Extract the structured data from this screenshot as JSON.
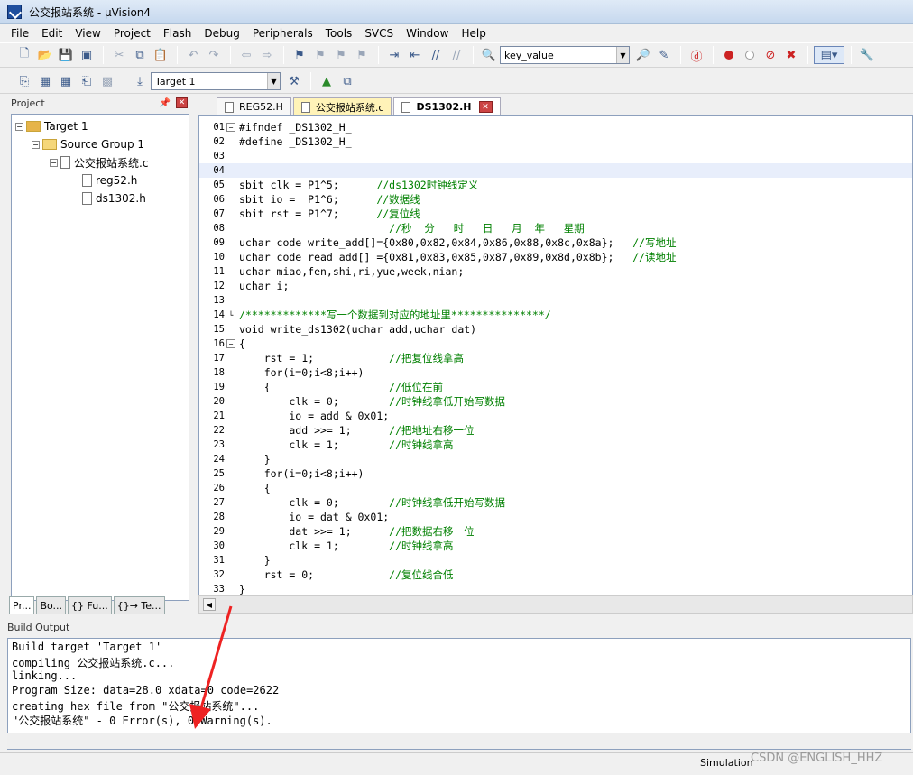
{
  "window": {
    "title": "公交报站系统 - µVision4"
  },
  "menu": [
    "File",
    "Edit",
    "View",
    "Project",
    "Flash",
    "Debug",
    "Peripherals",
    "Tools",
    "SVCS",
    "Window",
    "Help"
  ],
  "toolbar": {
    "find_value": "key_value",
    "target": "Target 1"
  },
  "project": {
    "header": "Project",
    "tree": [
      {
        "label": "Target 1"
      },
      {
        "label": "Source Group 1"
      },
      {
        "label": "公交报站系统.c"
      },
      {
        "label": "reg52.h"
      },
      {
        "label": "ds1302.h"
      }
    ],
    "tabs": [
      "Pr...",
      "Bo...",
      "{} Fu...",
      "{}→ Te..."
    ]
  },
  "editor_tabs": [
    {
      "label": "REG52.H"
    },
    {
      "label": "公交报站系统.c"
    },
    {
      "label": "DS1302.H"
    }
  ],
  "code": [
    {
      "n": "01",
      "t": "#ifndef _DS1302_H_",
      "c": ""
    },
    {
      "n": "02",
      "t": "#define _DS1302_H_",
      "c": ""
    },
    {
      "n": "03",
      "t": "",
      "c": ""
    },
    {
      "n": "04",
      "t": "",
      "c": ""
    },
    {
      "n": "05",
      "t": "sbit clk = P1^5;      ",
      "c": "//ds1302时钟线定义"
    },
    {
      "n": "06",
      "t": "sbit io =  P1^6;      ",
      "c": "//数据线"
    },
    {
      "n": "07",
      "t": "sbit rst = P1^7;      ",
      "c": "//复位线"
    },
    {
      "n": "08",
      "t": "                        ",
      "c": "//秒  分   时   日   月  年   星期"
    },
    {
      "n": "09",
      "t": "uchar code write_add[]={0x80,0x82,0x84,0x86,0x88,0x8c,0x8a};   ",
      "c": "//写地址"
    },
    {
      "n": "10",
      "t": "uchar code read_add[] ={0x81,0x83,0x85,0x87,0x89,0x8d,0x8b};   ",
      "c": "//读地址"
    },
    {
      "n": "11",
      "t": "uchar miao,fen,shi,ri,yue,week,nian;",
      "c": ""
    },
    {
      "n": "12",
      "t": "uchar i;",
      "c": ""
    },
    {
      "n": "13",
      "t": "",
      "c": ""
    },
    {
      "n": "14",
      "t": "",
      "c": "/*************写一个数据到对应的地址里***************/"
    },
    {
      "n": "15",
      "t": "void write_ds1302(uchar add,uchar dat)",
      "c": ""
    },
    {
      "n": "16",
      "t": "{",
      "c": ""
    },
    {
      "n": "17",
      "t": "    rst = 1;            ",
      "c": "//把复位线拿高"
    },
    {
      "n": "18",
      "t": "    for(i=0;i<8;i++)",
      "c": ""
    },
    {
      "n": "19",
      "t": "    {                   ",
      "c": "//低位在前"
    },
    {
      "n": "20",
      "t": "        clk = 0;        ",
      "c": "//时钟线拿低开始写数据"
    },
    {
      "n": "21",
      "t": "        io = add & 0x01;",
      "c": ""
    },
    {
      "n": "22",
      "t": "        add >>= 1;      ",
      "c": "//把地址右移一位"
    },
    {
      "n": "23",
      "t": "        clk = 1;        ",
      "c": "//时钟线拿高"
    },
    {
      "n": "24",
      "t": "    }",
      "c": ""
    },
    {
      "n": "25",
      "t": "    for(i=0;i<8;i++)",
      "c": ""
    },
    {
      "n": "26",
      "t": "    {",
      "c": ""
    },
    {
      "n": "27",
      "t": "        clk = 0;        ",
      "c": "//时钟线拿低开始写数据"
    },
    {
      "n": "28",
      "t": "        io = dat & 0x01;",
      "c": ""
    },
    {
      "n": "29",
      "t": "        dat >>= 1;      ",
      "c": "//把数据右移一位"
    },
    {
      "n": "30",
      "t": "        clk = 1;        ",
      "c": "//时钟线拿高"
    },
    {
      "n": "31",
      "t": "    }",
      "c": ""
    },
    {
      "n": "32",
      "t": "    rst = 0;            ",
      "c": "//复位线合低"
    },
    {
      "n": "33",
      "t": "}",
      "c": ""
    }
  ],
  "build": {
    "header": "Build Output",
    "lines": [
      "Build target 'Target 1'",
      "compiling 公交报站系统.c...",
      "linking...",
      "Program Size: data=28.0 xdata=0 code=2622",
      "creating hex file from \"公交报站系统\"...",
      "\"公交报站系统\" - 0 Error(s), 0 Warning(s)."
    ]
  },
  "status": {
    "mode": "Simulation",
    "watermark": "CSDN @ENGLISH_HHZ"
  }
}
